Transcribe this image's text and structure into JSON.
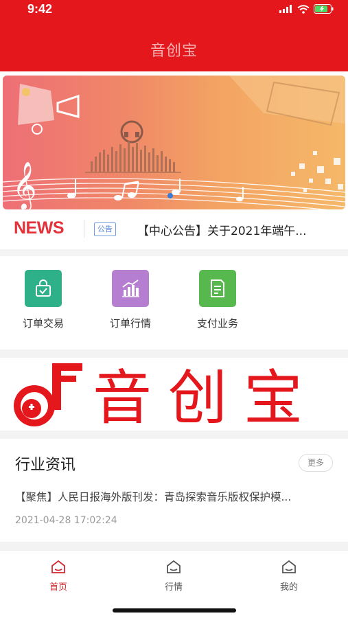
{
  "status_bar": {
    "time": "9:42"
  },
  "app": {
    "title": "音创宝",
    "brand_color": "#e4171d"
  },
  "news": {
    "logo": "NEWS",
    "tag": "公告",
    "headline": "【中心公告】关于2021年端午..."
  },
  "menu": {
    "items": [
      {
        "label": "订单交易",
        "icon": "shopping-bag-check-icon",
        "color": "#2eb189"
      },
      {
        "label": "订单行情",
        "icon": "bar-chart-trend-icon",
        "color": "#b57ed0"
      },
      {
        "label": "支付业务",
        "icon": "document-icon",
        "color": "#57b84d"
      }
    ]
  },
  "brand_banner": {
    "text": "音创宝"
  },
  "industry": {
    "title": "行业资讯",
    "more_label": "更多",
    "article": {
      "title": "【聚焦】人民日报海外版刊发：青岛探索音乐版权保护模...",
      "date": "2021-04-28 17:02:24"
    }
  },
  "tabbar": {
    "tabs": [
      {
        "label": "首页",
        "icon": "home-icon",
        "active": true
      },
      {
        "label": "行情",
        "icon": "home-icon",
        "active": false
      },
      {
        "label": "我的",
        "icon": "home-icon",
        "active": false
      }
    ],
    "active_color": "#d0282e",
    "inactive_color": "#555555"
  }
}
